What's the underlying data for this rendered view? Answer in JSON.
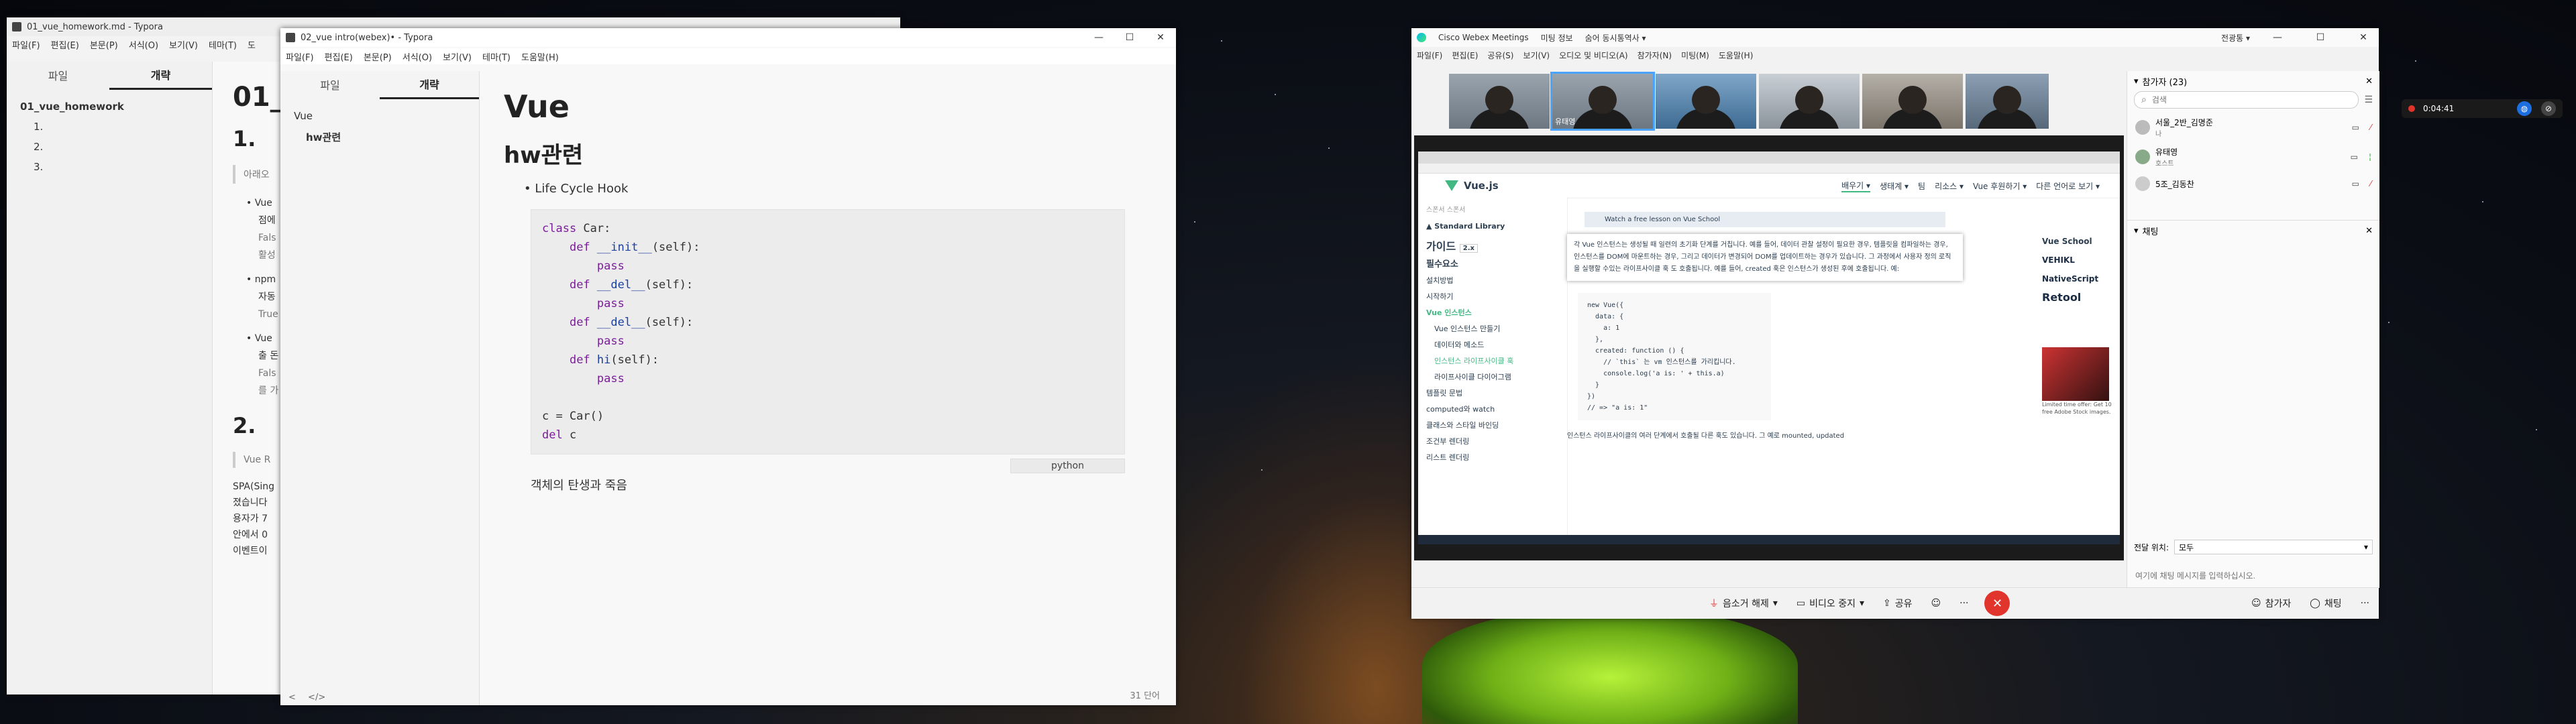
{
  "typora1": {
    "title": "01_vue_homework.md - Typora",
    "menu": [
      "파일(F)",
      "편집(E)",
      "본문(P)",
      "서식(O)",
      "보기(V)",
      "테마(T)",
      "도"
    ],
    "tabs": [
      "파일",
      "개략"
    ],
    "outline": [
      "01_vue_homework",
      "1.",
      "2.",
      "3."
    ],
    "heading1": "01_v",
    "h2_1": "1.",
    "quote": "아래오",
    "bullets": [
      {
        "line1": "Vue",
        "line2": "점에",
        "note1": "Fals",
        "note2": "활성"
      },
      {
        "line1": "npm",
        "line2": "자동",
        "note1": "True",
        "note2": ""
      },
      {
        "line1": "Vue",
        "line2": "출 돈",
        "note1": "Fals",
        "note2": "를 가"
      }
    ],
    "h2_2": "2.",
    "quote2": "Vue R",
    "para": [
      "SPA(Sing",
      "졌습니다",
      "용자가 7",
      "안에서 0",
      "이벤트이"
    ]
  },
  "typora2": {
    "title": "02_vue intro(webex)• - Typora",
    "menu": [
      "파일(F)",
      "편집(E)",
      "본문(P)",
      "서식(O)",
      "보기(V)",
      "테마(T)",
      "도움말(H)"
    ],
    "tabs": [
      "파일",
      "개략"
    ],
    "outline": [
      "Vue",
      "hw관련"
    ],
    "h1": "Vue",
    "h2": "hw관련",
    "bullet": "Life Cycle Hook",
    "code_lang": "python",
    "after_code": "객체의 탄생과 죽음",
    "word_count": "31 단어",
    "footer_left": "<",
    "footer_code": "</>"
  },
  "webex": {
    "title": "Cisco Webex Meetings",
    "tabs": [
      "미팅 정보",
      "숨어 동시통역사 ▾"
    ],
    "header_right": "전광통 ▾",
    "menu": [
      "파일(F)",
      "편집(E)",
      "공유(S)",
      "보기(V)",
      "오디오 및 비디오(A)",
      "참가자(N)",
      "미팅(M)",
      "도움말(H)"
    ],
    "participants_header": "참가자 (23)",
    "search_placeholder": "검색",
    "participants": [
      {
        "name": "서울_2반_김명준",
        "role": "나"
      },
      {
        "name": "유태영",
        "role": "호스트"
      },
      {
        "name": "5조_김동찬",
        "role": ""
      }
    ],
    "chat_header": "채팅",
    "send_to_label": "전달 위치:",
    "send_to_value": "모두",
    "chat_placeholder": "여기에 채팅 메시지를 입력하십시오.",
    "controls": [
      "음소거 해제",
      "비디오 중지",
      "공유"
    ],
    "bottom_right": [
      "참가자",
      "채팅"
    ],
    "gallery_names": [
      "",
      "유태영",
      "",
      "",
      "",
      ""
    ]
  },
  "shared_screen": {
    "brand": "Vue.js",
    "nav": [
      "배우기 ▾",
      "생태계 ▾",
      "팀",
      "리소스 ▾",
      "Vue 후원하기 ▾",
      "다른 언어로 보기 ▾"
    ],
    "sidebar": [
      "설치방법",
      "시작하기",
      "Vue 인스턴스",
      "Vue 인스턴스 만들기",
      "데이터와 메소드",
      "인스턴스 라이프사이클 훅",
      "라이프사이클 다이어그램",
      "템플릿 문법",
      "computed와 watch",
      "클래스와 스타일 바인딩",
      "조건부 렌더링",
      "리스트 렌더링"
    ],
    "guide_label": "가이드",
    "guide_ver": "2.x",
    "essentials": "필수요소",
    "sponsor_label": "스폰서 스폰서",
    "lesson_banner": "Watch a free lesson on Vue School",
    "paragraph": "각 Vue 인스턴스는 생성될 때 일련의 초기화 단계를 거칩니다. 예를 들어, 데이터 관찰 설정이 필요한 경우, 템플릿을 컴파일하는 경우, 인스턴스를 DOM에 마운트하는 경우, 그리고 데이터가 변경되어 DOM를 업데이트하는 경우가 있습니다. 그 과정에서 사용자 정의 로직을 실행할 수있는 라이프사이클 훅 도 호출됩니다. 예를 들어, created 훅은 인스턴스가 생성된 후에 호출됩니다. 예:",
    "code": "new Vue({\n  data: {\n    a: 1\n  },\n  created: function () {\n    // `this` 는 vm 인스턴스를 가리킵니다.\n    console.log('a is: ' + this.a)\n  }\n})\n// => \"a is: 1\"",
    "paragraph2": "인스턴스 라이프사이클의 여러 단계에서 호출될 다른 훅도 있습니다. 그 예로 mounted, updated",
    "sponsors": [
      "Vue School",
      "VEHIKL",
      "NativeScript",
      "Retool"
    ],
    "ad_text": "Limited time offer: Get 10 free Adobe Stock images."
  },
  "recording": {
    "time": "0:04:41"
  }
}
